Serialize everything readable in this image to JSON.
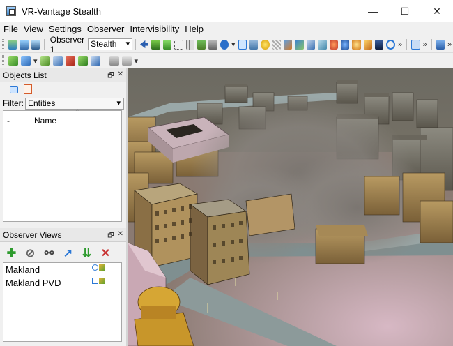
{
  "window": {
    "title": "VR-Vantage Stealth",
    "controls": {
      "minimize": "—",
      "maximize": "☐",
      "close": "✕"
    }
  },
  "menu": [
    {
      "label": "File",
      "mnemonic": "F",
      "rest": "ile"
    },
    {
      "label": "View",
      "mnemonic": "V",
      "rest": "iew"
    },
    {
      "label": "Settings",
      "mnemonic": "S",
      "rest": "ettings"
    },
    {
      "label": "Observer",
      "mnemonic": "O",
      "rest": "bserver"
    },
    {
      "label": "Intervisibility",
      "mnemonic": "I",
      "rest": "ntervisibility"
    },
    {
      "label": "Help",
      "mnemonic": "H",
      "rest": "elp"
    }
  ],
  "toolbar": {
    "observer_label": "Observer 1",
    "observer_mode": "Stealth",
    "overflow": "»"
  },
  "objects_panel": {
    "title": "Objects List",
    "filter_label": "Filter:",
    "filter_value": "Entities",
    "columns": [
      "-",
      "Name"
    ]
  },
  "observer_views": {
    "title": "Observer Views",
    "items": [
      {
        "name": "Makland"
      },
      {
        "name": "Makland PVD"
      }
    ]
  },
  "panel_buttons": {
    "float": "🗗",
    "close": "✕"
  },
  "colors": {
    "accent": "#2b78d6",
    "green": "#2e9b2e",
    "red": "#c83232"
  }
}
